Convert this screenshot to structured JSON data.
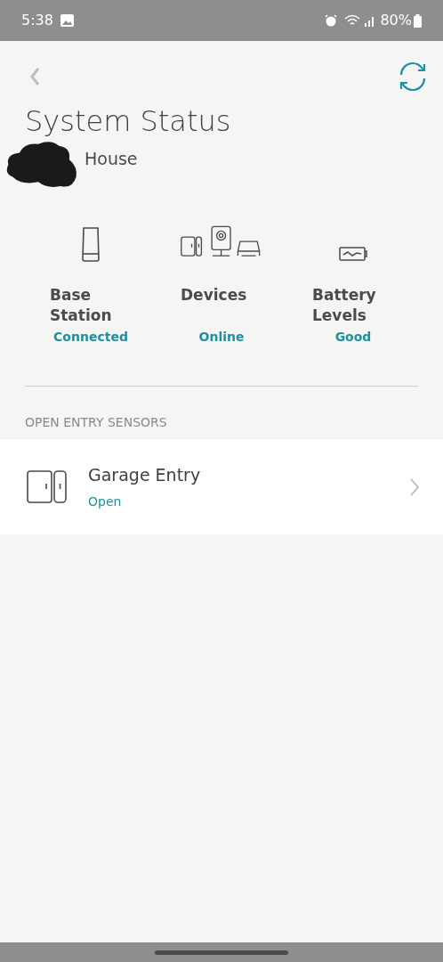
{
  "status_bar": {
    "time": "5:38",
    "battery": "80%"
  },
  "header": {
    "title": "System Status",
    "subtitle": "House"
  },
  "status_items": [
    {
      "kind": "base",
      "label": "Base Station",
      "status": "Connected"
    },
    {
      "kind": "devices",
      "label": "Devices",
      "status": "Online"
    },
    {
      "kind": "battery",
      "label": "Battery Levels",
      "status": "Good"
    }
  ],
  "section": {
    "title": "OPEN ENTRY SENSORS",
    "items": [
      {
        "name": "Garage Entry",
        "status": "Open"
      }
    ]
  }
}
